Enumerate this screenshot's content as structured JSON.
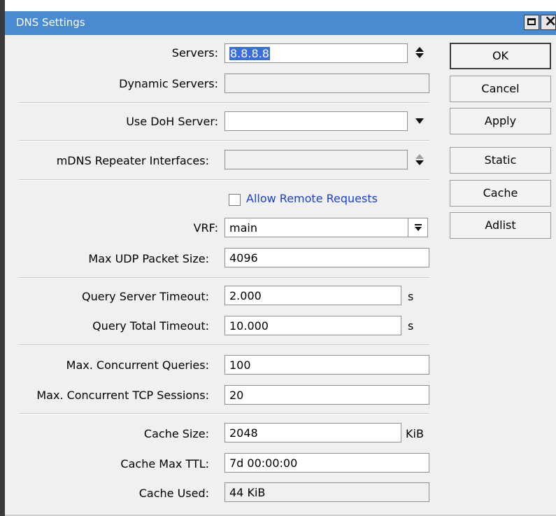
{
  "window": {
    "title": "DNS Settings"
  },
  "fields": {
    "servers": {
      "label": "Servers:",
      "value": "8.8.8.8"
    },
    "dynamic_servers": {
      "label": "Dynamic Servers:",
      "value": ""
    },
    "use_doh_server": {
      "label": "Use DoH Server:",
      "value": ""
    },
    "mdns_repeater": {
      "label": "mDNS Repeater Interfaces:",
      "value": ""
    },
    "allow_remote": {
      "label": "Allow Remote Requests",
      "checked": false
    },
    "vrf": {
      "label": "VRF:",
      "value": "main"
    },
    "max_udp": {
      "label": "Max UDP Packet Size:",
      "value": "4096"
    },
    "query_server_timeout": {
      "label": "Query Server Timeout:",
      "value": "2.000",
      "unit": "s"
    },
    "query_total_timeout": {
      "label": "Query Total Timeout:",
      "value": "10.000",
      "unit": "s"
    },
    "max_concurrent_queries": {
      "label": "Max. Concurrent Queries:",
      "value": "100"
    },
    "max_concurrent_tcp": {
      "label": "Max. Concurrent TCP Sessions:",
      "value": "20"
    },
    "cache_size": {
      "label": "Cache Size:",
      "value": "2048",
      "unit": "KiB"
    },
    "cache_max_ttl": {
      "label": "Cache Max TTL:",
      "value": "7d 00:00:00"
    },
    "cache_used": {
      "label": "Cache Used:",
      "value": "44 KiB"
    }
  },
  "buttons": {
    "ok": "OK",
    "cancel": "Cancel",
    "apply": "Apply",
    "static": "Static",
    "cache": "Cache",
    "adlist": "Adlist"
  },
  "colors": {
    "titlebar": "#4a8ad1",
    "selection": "#3a6fd8",
    "checkbox_label": "#1a3fd6",
    "background": "#f0f0f0"
  },
  "icons": {
    "servers_control": "up-down-arrows-icon",
    "doh_control": "dropdown-triangle-icon",
    "mdns_control": "up-down-arrows-icon",
    "vrf_control": "dropdown-arrow-icon"
  }
}
